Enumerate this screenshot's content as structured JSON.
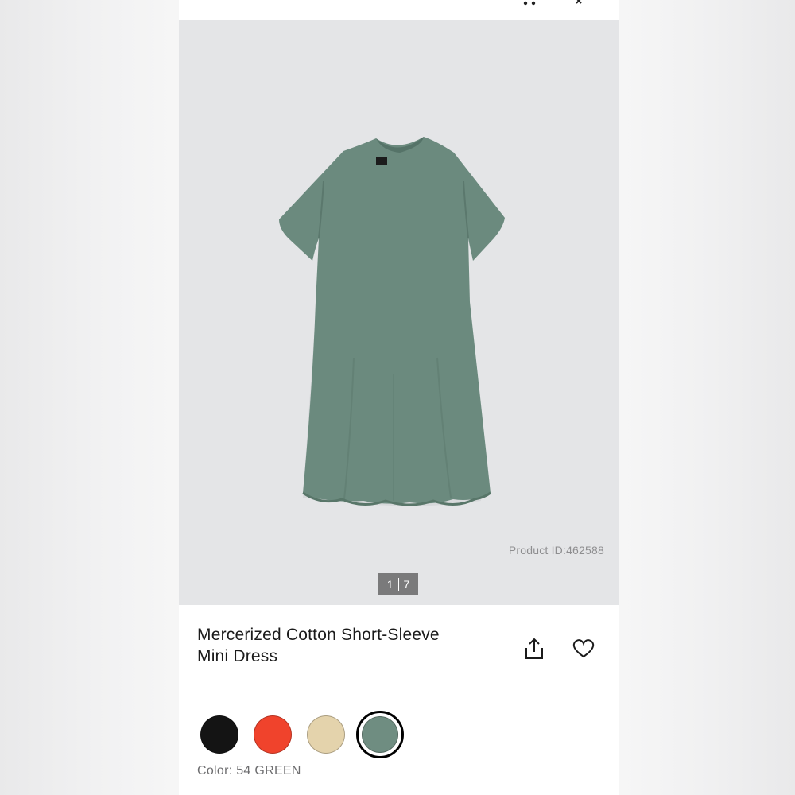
{
  "gallery": {
    "product_id": "Product ID:462588",
    "current_page": "1",
    "total_pages": "7"
  },
  "product": {
    "title_line1": "Mercerized Cotton Short-Sleeve",
    "title_line2": "Mini Dress",
    "color_label": "Color: 54 GREEN"
  },
  "icons": {
    "share": "share-icon",
    "favorite": "heart-icon",
    "more": "more-dots-icon",
    "close": "close-icon"
  },
  "colors": {
    "dress": "#6b8a7e",
    "swatches": [
      "#141414",
      "#f0432c",
      "#e4d3ac",
      "#6f8d81"
    ],
    "selected_swatch_index": 3
  }
}
